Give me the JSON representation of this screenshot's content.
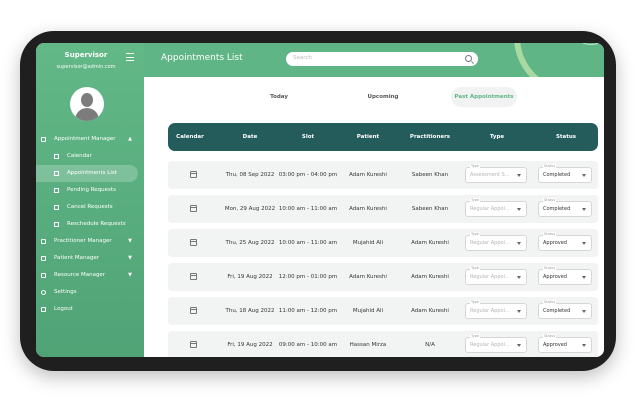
{
  "sidebar": {
    "role": "Supervisor",
    "email": "supervisor@admin.com",
    "items": [
      {
        "label": "Appointment Manager",
        "icon": "calendar-icon",
        "expanded": true
      },
      {
        "label": "Calendar",
        "icon": "calendar-icon"
      },
      {
        "label": "Appointments List",
        "icon": "list-icon",
        "active": true
      },
      {
        "label": "Pending Requests",
        "icon": "clock-icon"
      },
      {
        "label": "Cancel Requests",
        "icon": "cancel-icon"
      },
      {
        "label": "Reschedule Requests",
        "icon": "reschedule-icon"
      },
      {
        "label": "Practitioner Manager",
        "icon": "practitioner-icon"
      },
      {
        "label": "Patient Manager",
        "icon": "patient-icon"
      },
      {
        "label": "Resource Manager",
        "icon": "resource-icon"
      },
      {
        "label": "Settings",
        "icon": "gear-icon"
      },
      {
        "label": "Logout",
        "icon": "logout-icon"
      }
    ]
  },
  "header": {
    "title": "Appointments List",
    "search_placeholder": "Search"
  },
  "tabs": [
    {
      "label": "Today"
    },
    {
      "label": "Upcoming"
    },
    {
      "label": "Past Appointments",
      "active": true
    }
  ],
  "table": {
    "columns": [
      "Calendar",
      "Date",
      "Slot",
      "Patient",
      "Practitioners",
      "Type",
      "Status"
    ],
    "type_label": "Type",
    "status_label": "Status",
    "rows": [
      {
        "date": "Thu, 08 Sep 2022",
        "slot": "03:00 pm - 04:00 pm",
        "patient": "Adam Kureshi",
        "practitioner": "Sabeen Khan",
        "type": "Assessment S...",
        "status": "Completed"
      },
      {
        "date": "Mon, 29 Aug 2022",
        "slot": "10:00 am - 11:00 am",
        "patient": "Adam Kureshi",
        "practitioner": "Sabeen Khan",
        "type": "Regular Appoi...",
        "status": "Completed"
      },
      {
        "date": "Thu, 25 Aug 2022",
        "slot": "10:00 am - 11:00 am",
        "patient": "Mujahid Ali",
        "practitioner": "Adam Kureshi",
        "type": "Regular Appoi...",
        "status": "Approved"
      },
      {
        "date": "Fri, 19 Aug 2022",
        "slot": "12:00 pm - 01:00 pm",
        "patient": "Adam Kureshi",
        "practitioner": "Adam Kureshi",
        "type": "Regular Appoi...",
        "status": "Approved"
      },
      {
        "date": "Thu, 18 Aug 2022",
        "slot": "11:00 am - 12:00 pm",
        "patient": "Mujahid Ali",
        "practitioner": "Adam Kureshi",
        "type": "Regular Appoi...",
        "status": "Completed"
      },
      {
        "date": "Fri, 19 Aug 2022",
        "slot": "09:00 am - 10:00 am",
        "patient": "Hassan Mirza",
        "practitioner": "N/A",
        "type": "Regular Appoi...",
        "status": "Approved"
      }
    ]
  },
  "colors": {
    "brand_green": "#5fb585",
    "table_header": "#245c5c"
  }
}
